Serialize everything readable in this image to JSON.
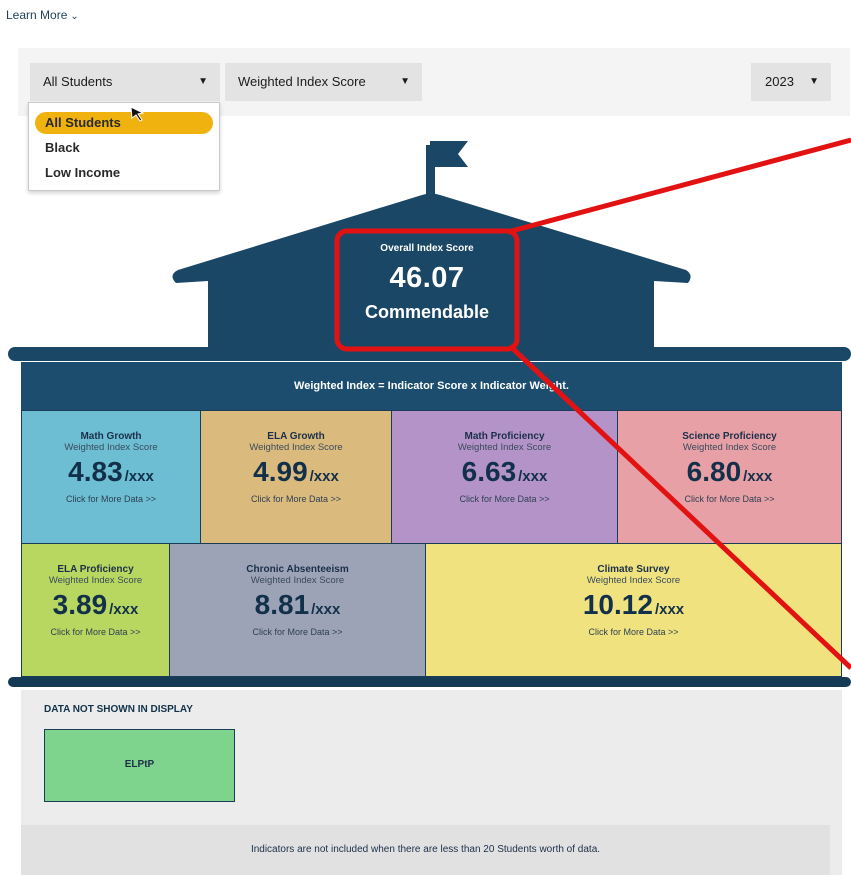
{
  "header": {
    "learn_more": "Learn More"
  },
  "filters": {
    "group": {
      "selected": "All Students",
      "options": [
        "All Students",
        "Black",
        "Low Income"
      ]
    },
    "metric": {
      "selected": "Weighted Index Score"
    },
    "year": {
      "selected": "2023"
    }
  },
  "overall": {
    "label": "Overall Index Score",
    "score": "46.07",
    "rating": "Commendable"
  },
  "banner": {
    "text": "Weighted Index = Indicator Score x Indicator Weight."
  },
  "indicators": [
    {
      "title": "Math Growth",
      "subtitle": "Weighted Index Score",
      "value": "4.83",
      "denominator": "/xxx",
      "link": "Click for More Data >>"
    },
    {
      "title": "ELA Growth",
      "subtitle": "Weighted Index Score",
      "value": "4.99",
      "denominator": "/xxx",
      "link": "Click for More Data >>"
    },
    {
      "title": "Math Proficiency",
      "subtitle": "Weighted Index Score",
      "value": "6.63",
      "denominator": "/xxx",
      "link": "Click for More Data >>"
    },
    {
      "title": "Science Proficiency",
      "subtitle": "Weighted Index Score",
      "value": "6.80",
      "denominator": "/xxx",
      "link": "Click for More Data >>"
    },
    {
      "title": "ELA Proficiency",
      "subtitle": "Weighted Index Score",
      "value": "3.89",
      "denominator": "/xxx",
      "link": "Click for More Data >>"
    },
    {
      "title": "Chronic Absenteeism",
      "subtitle": "Weighted Index Score",
      "value": "8.81",
      "denominator": "/xxx",
      "link": "Click for More Data >>"
    },
    {
      "title": "Climate Survey",
      "subtitle": "Weighted Index Score",
      "value": "10.12",
      "denominator": "/xxx",
      "link": "Click for More Data >>"
    }
  ],
  "not_shown": {
    "title": "DATA NOT SHOWN IN DISPLAY",
    "items": [
      "ELPtP"
    ]
  },
  "footer": {
    "note": "Indicators are not included when there are less than 20 Students worth of data."
  },
  "colors": {
    "navy": "#1b4766",
    "highlight": "#f0b20f",
    "annotation": "#e31212",
    "math_growth": "#6dbed3",
    "ela_growth": "#dbbb7d",
    "math_proficiency": "#b493c9",
    "science_proficiency": "#e7a0a6",
    "ela_proficiency": "#b8d760",
    "chronic_absenteeism": "#9ca3b6",
    "climate_survey": "#f0e37f",
    "elptp": "#7fd48d"
  }
}
